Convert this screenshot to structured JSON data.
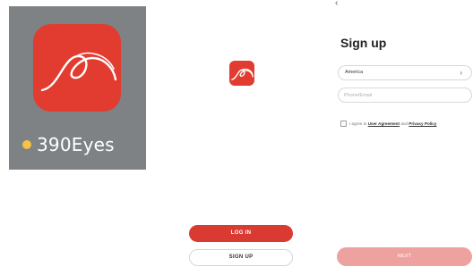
{
  "app_tile": {
    "app_name": "390Eyes",
    "status_dot_color": "#f6c343",
    "icon": "390eyes-logo-icon",
    "brand_color": "#e23b2f"
  },
  "welcome": {
    "icon": "390eyes-logo-icon",
    "login_label": "LOG IN",
    "signup_label": "SIGN UP"
  },
  "signup": {
    "back_icon": "chevron-left-icon",
    "back_glyph": "‹",
    "title": "Sign up",
    "country_value": "America",
    "country_chevron": "›",
    "phone_placeholder": "Phone/Email",
    "agree_prefix": "I agree to",
    "user_agreement": "User Agreement",
    "and_text": "and",
    "privacy_policy": "Privacy Policy",
    "next_label": "NEXT"
  }
}
